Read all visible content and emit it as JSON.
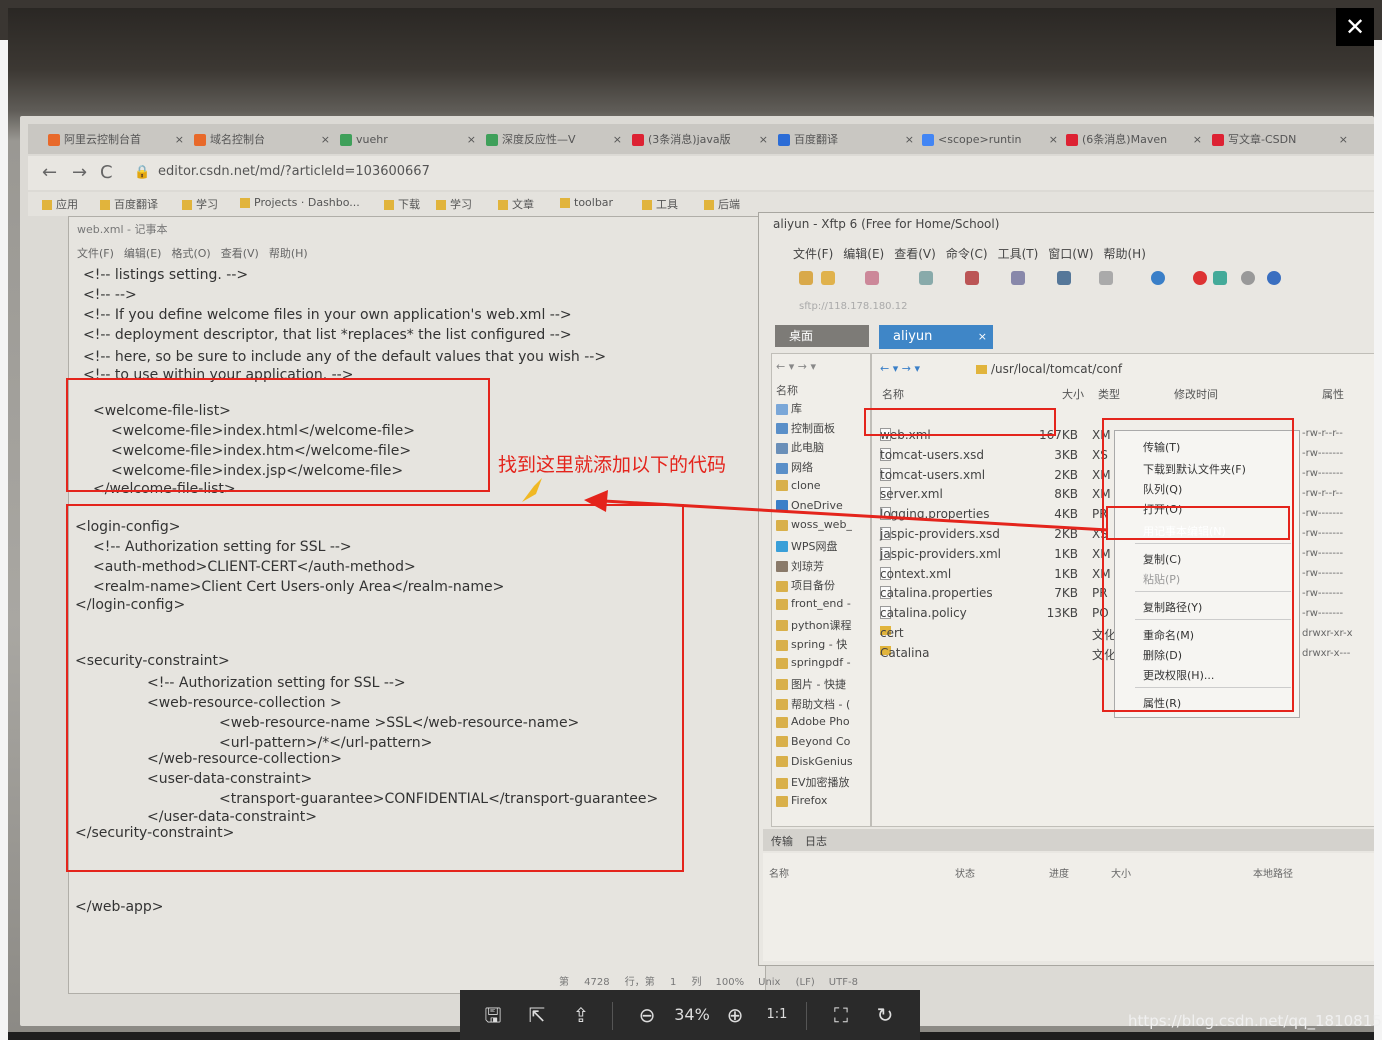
{
  "viewer": {
    "close_label": "✕",
    "zoom": "34%",
    "actual_size": "1:1",
    "watermark": "https://blog.csdn.net/qq_18108159"
  },
  "browser": {
    "tabs": [
      {
        "label": "阿里云控制台首",
        "color": "#e8692a"
      },
      {
        "label": "域名控制台",
        "color": "#e8692a"
      },
      {
        "label": "vuehr",
        "color": "#3fa05a"
      },
      {
        "label": "深度反应性—V",
        "color": "#3fa05a"
      },
      {
        "label": "(3条消息)java版",
        "color": "#d23"
      },
      {
        "label": "百度翻译",
        "color": "#2b6cd6"
      },
      {
        "label": "<scope>runtin",
        "color": "#4285f4"
      },
      {
        "label": "(6条消息)Maven",
        "color": "#d23"
      },
      {
        "label": "写文章-CSDN",
        "color": "#d23"
      }
    ],
    "url": "editor.csdn.net/md/?articleId=103600667",
    "bookmarks": [
      "应用",
      "百度翻译",
      "学习",
      "Projects · Dashbo...",
      "下载",
      "学习",
      "文章",
      "toolbar",
      "工具",
      "后端"
    ]
  },
  "notepad": {
    "title": "web.xml - 记事本",
    "menu": [
      "文件(F)",
      "编辑(E)",
      "格式(O)",
      "查看(V)",
      "帮助(H)"
    ],
    "lines": [
      "<!-- listings setting.                                                             -->",
      "<!--                                                                              -->",
      "<!-- If you define welcome files in your own application's web.xml        -->",
      "<!-- deployment descriptor, that list *replaces* the list configured      -->",
      "<!-- here, so be sure to include any of the default values that you wish  -->",
      "<!-- to use within your application.                                        -->",
      "<welcome-file-list>",
      "<welcome-file>index.html</welcome-file>",
      "<welcome-file>index.htm</welcome-file>",
      "<welcome-file>index.jsp</welcome-file>",
      "</welcome-file-list>",
      "<login-config>",
      "<!-- Authorization setting for SSL -->",
      "<auth-method>CLIENT-CERT</auth-method>",
      "<realm-name>Client Cert Users-only Area</realm-name>",
      "</login-config>",
      "<security-constraint>",
      "<!-- Authorization setting for SSL -->",
      "<web-resource-collection >",
      "<web-resource-name >SSL</web-resource-name>",
      "<url-pattern>/*</url-pattern>",
      "</web-resource-collection>",
      "<user-data-constraint>",
      "<transport-guarantee>CONFIDENTIAL</transport-guarantee>",
      "</user-data-constraint>",
      "</security-constraint>",
      "</web-app>"
    ],
    "status": [
      "第 4728 行，第 1 列",
      "100%",
      "Unix (LF)",
      "UTF-8"
    ]
  },
  "annotation": {
    "text": "找到这里就添加以下的代码"
  },
  "xftp": {
    "title": "aliyun - Xftp 6 (Free for Home/School)",
    "menu": [
      "文件(F)",
      "编辑(E)",
      "查看(V)",
      "命令(C)",
      "工具(T)",
      "窗口(W)",
      "帮助(H)"
    ],
    "address_hint": "sftp://118.178.180.12",
    "left_tab": "桌面",
    "right_tab": "aliyun",
    "path": "/usr/local/tomcat/conf",
    "left_header": "名称",
    "left_items": [
      "库",
      "控制面板",
      "此电脑",
      "网络",
      "clone",
      "OneDrive",
      "woss_web_",
      "WPS网盘",
      "刘琼芳",
      "项目备份",
      "front_end -",
      "python课程",
      "spring - 快",
      "springpdf -",
      "图片 - 快捷",
      "帮助文档 - (",
      "Adobe Pho",
      "Beyond Co",
      "DiskGenius",
      "EV加密播放",
      "Firefox"
    ],
    "columns": [
      "名称",
      "大小",
      "类型",
      "修改时间",
      "属性"
    ],
    "files": [
      {
        "name": "web.xml",
        "size": "167KB",
        "type": "XM",
        "kind": "file"
      },
      {
        "name": "tomcat-users.xsd",
        "size": "3KB",
        "type": "XS",
        "kind": "file"
      },
      {
        "name": "tomcat-users.xml",
        "size": "2KB",
        "type": "XM",
        "kind": "file"
      },
      {
        "name": "server.xml",
        "size": "8KB",
        "type": "XM",
        "kind": "file"
      },
      {
        "name": "logging.properties",
        "size": "4KB",
        "type": "PR",
        "kind": "file"
      },
      {
        "name": "jaspic-providers.xsd",
        "size": "2KB",
        "type": "XS",
        "kind": "file"
      },
      {
        "name": "jaspic-providers.xml",
        "size": "1KB",
        "type": "XM",
        "kind": "file"
      },
      {
        "name": "context.xml",
        "size": "1KB",
        "type": "XM",
        "kind": "file"
      },
      {
        "name": "catalina.properties",
        "size": "7KB",
        "type": "PR",
        "kind": "file"
      },
      {
        "name": "catalina.policy",
        "size": "13KB",
        "type": "PO",
        "kind": "file"
      },
      {
        "name": "cert",
        "size": "",
        "type": "文化",
        "kind": "folder"
      },
      {
        "name": "Catalina",
        "size": "",
        "type": "文化",
        "kind": "folder"
      }
    ],
    "perms": [
      "-rw-r--r--",
      "-rw-------",
      "-rw-------",
      "-rw-r--r--",
      "-rw-------",
      "-rw-------",
      "-rw-------",
      "-rw-------",
      "-rw-------",
      "-rw-------",
      "drwxr-xr-x",
      "drwxr-x---"
    ],
    "bottom_tabs": [
      "传输",
      "日志"
    ],
    "transfer_columns": [
      "名称",
      "状态",
      "进度",
      "大小",
      "本地路径"
    ]
  },
  "context_menu": {
    "items": [
      "传输(T)",
      "下载到默认文件夹(F)",
      "队列(Q)",
      "打开(O)",
      "用记事本编辑(N)",
      "复制(C)",
      "粘贴(P)",
      "复制路径(Y)",
      "重命名(M)",
      "删除(D)",
      "更改权限(H)...",
      "属性(R)"
    ],
    "highlighted": "用记事本编辑(N)"
  }
}
